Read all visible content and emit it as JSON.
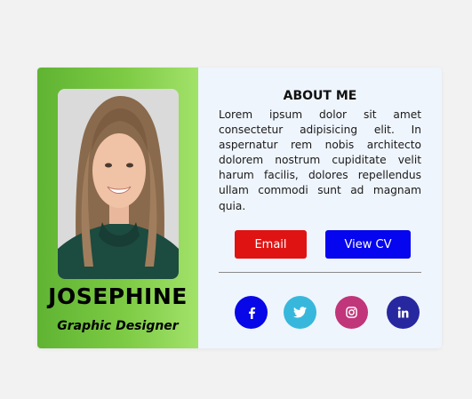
{
  "profile": {
    "name": "JOSEPHINE",
    "role": "Graphic Designer"
  },
  "about": {
    "title": "ABOUT ME",
    "text": "Lorem ipsum dolor sit amet consectetur adipisicing elit. In aspernatur rem nobis architecto dolorem nostrum cupiditate velit harum facilis, dolores repellendus ullam commodi sunt ad magnam quia."
  },
  "buttons": {
    "email_label": "Email",
    "cv_label": "View CV"
  },
  "social": [
    {
      "icon": "facebook-icon",
      "color": "#0707e8"
    },
    {
      "icon": "twitter-icon",
      "color": "#38b7dd"
    },
    {
      "icon": "instagram-icon",
      "color": "#c1357a"
    },
    {
      "icon": "linkedin-icon",
      "color": "#2727a0"
    }
  ],
  "colors": {
    "page_bg": "#f2f2f2",
    "panel_left_start": "#5fb432",
    "panel_left_end": "#a2e26a",
    "panel_right": "#eff5fd",
    "email_button": "#e01313",
    "cv_button": "#0505ef"
  }
}
